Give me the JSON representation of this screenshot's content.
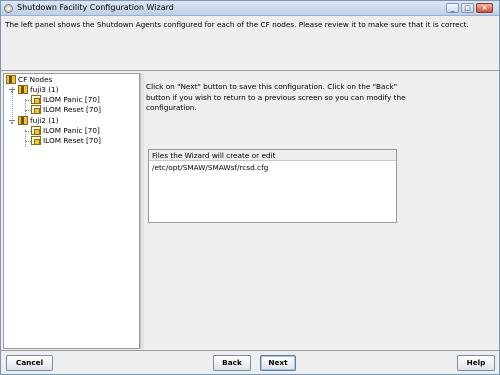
{
  "window": {
    "title": "Shutdown Facility Configuration Wizard",
    "controls": {
      "minimize": "_",
      "maximize": "□",
      "close": "×"
    }
  },
  "header": {
    "text": "The left panel shows the Shutdown Agents configured for each of the CF nodes. Please review it to make sure that it is correct."
  },
  "tree": {
    "root": "CF Nodes",
    "nodes": [
      {
        "label": "fuji3 (1)",
        "agents": [
          "ILOM Panic [70]",
          "ILOM Reset [70]"
        ]
      },
      {
        "label": "fuji2 (1)",
        "agents": [
          "ILOM Panic [70]",
          "ILOM Reset [70]"
        ]
      }
    ]
  },
  "info": {
    "lines": [
      "Click on \"Next\" button to save this configuration. Click on the \"Back\"",
      "button if you wish to return to a previous screen so you can modify the",
      "configuration."
    ]
  },
  "files": {
    "header": "Files the Wizard will create or edit",
    "rows": [
      "/etc/opt/SMAW/SMAWsf/rcsd.cfg"
    ]
  },
  "buttons": {
    "cancel": "Cancel",
    "back": "Back",
    "next": "Next",
    "help": "Help"
  },
  "colors": {
    "titlebar": "#c9d8ec",
    "panel": "#eeeeee",
    "folder": "#f0c23a"
  },
  "icons": {
    "window": "app-icon",
    "folder": "folder-icon",
    "agent": "agent-icon"
  }
}
